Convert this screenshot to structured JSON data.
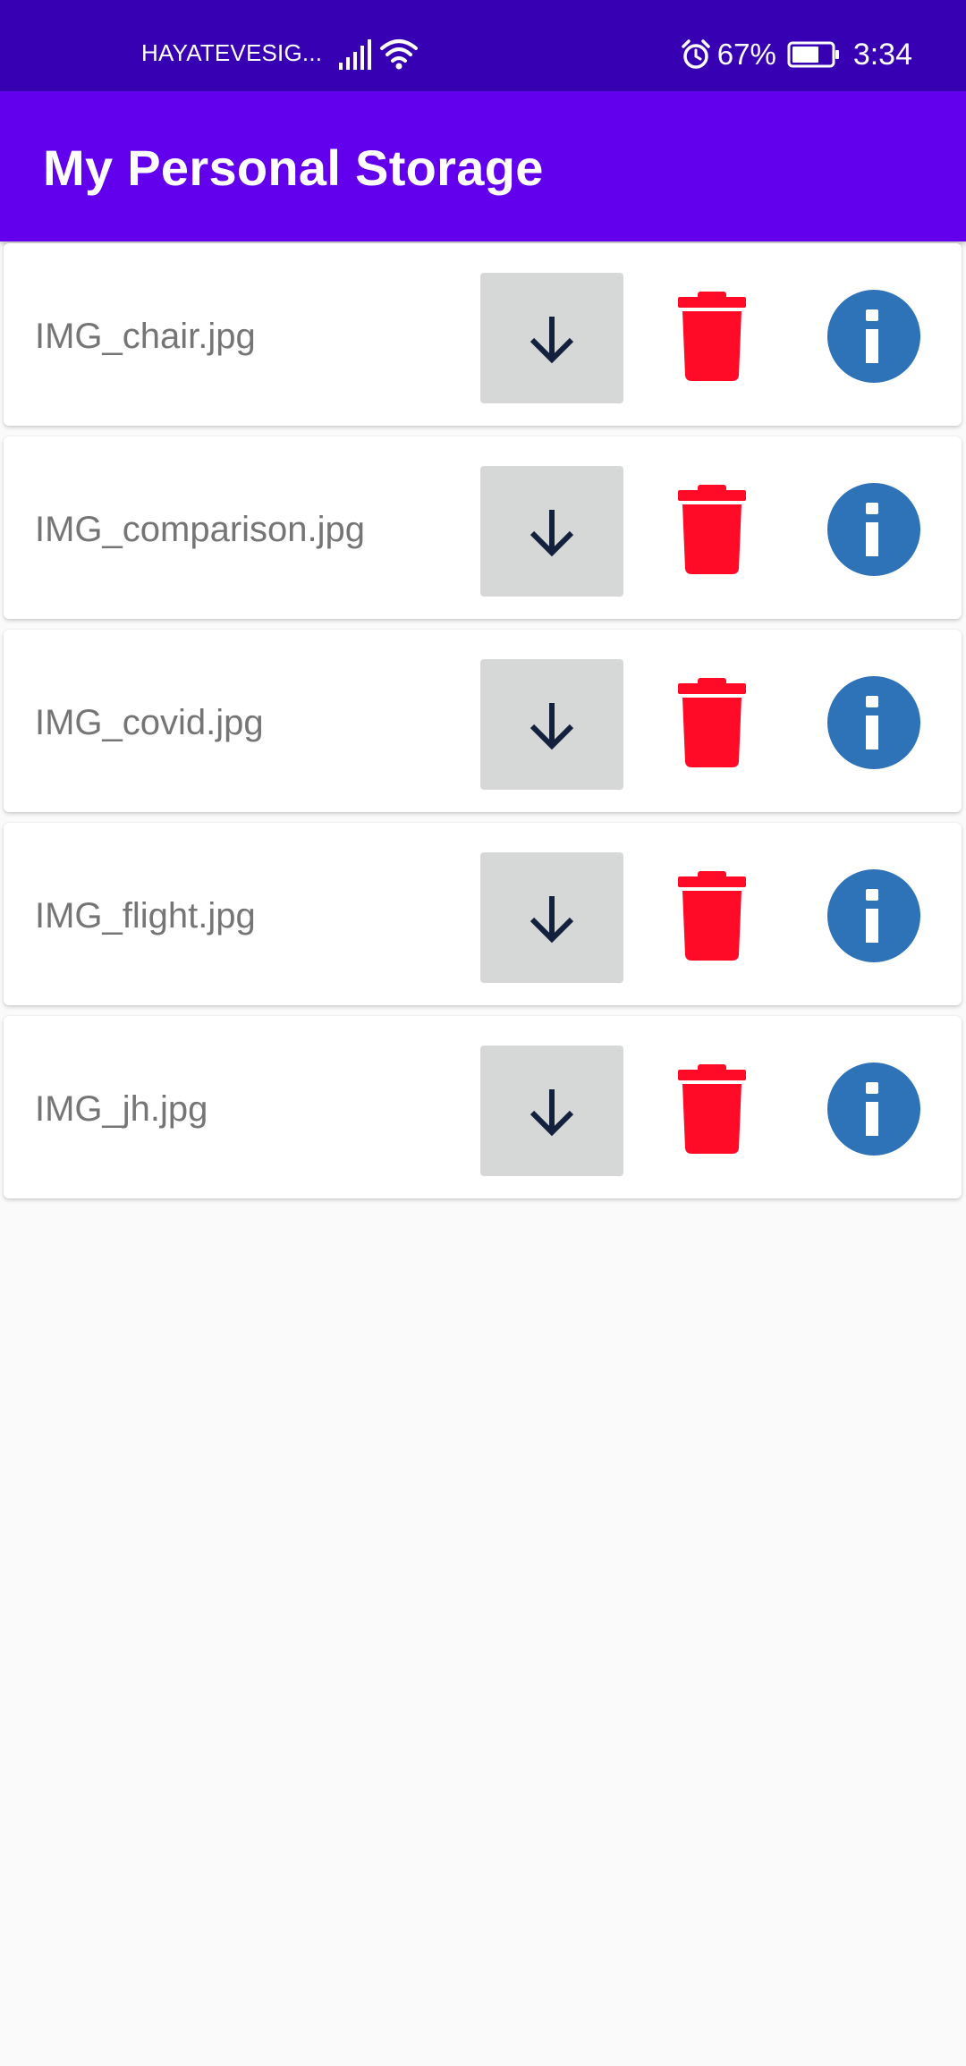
{
  "status_bar": {
    "carrier": "HAYATEVESIG...",
    "battery_percent": "67%",
    "time": "3:34",
    "icons": [
      "signal-icon",
      "wifi-icon",
      "alarm-icon",
      "battery-icon"
    ]
  },
  "app_bar": {
    "title": "My Personal Storage"
  },
  "files": [
    {
      "name": "IMG_chair.jpg"
    },
    {
      "name": "IMG_comparison.jpg"
    },
    {
      "name": "IMG_covid.jpg"
    },
    {
      "name": "IMG_flight.jpg"
    },
    {
      "name": "IMG_jh.jpg"
    }
  ],
  "row_icons": {
    "download": "arrow-down-icon",
    "delete": "trash-icon",
    "info": "info-icon"
  },
  "colors": {
    "status_bar": "#3700b3",
    "app_bar": "#6200ee",
    "download_bg": "#d6d7d7",
    "delete_red": "#ff0a27",
    "info_blue": "#2e72b8",
    "arrow": "#14213d"
  }
}
